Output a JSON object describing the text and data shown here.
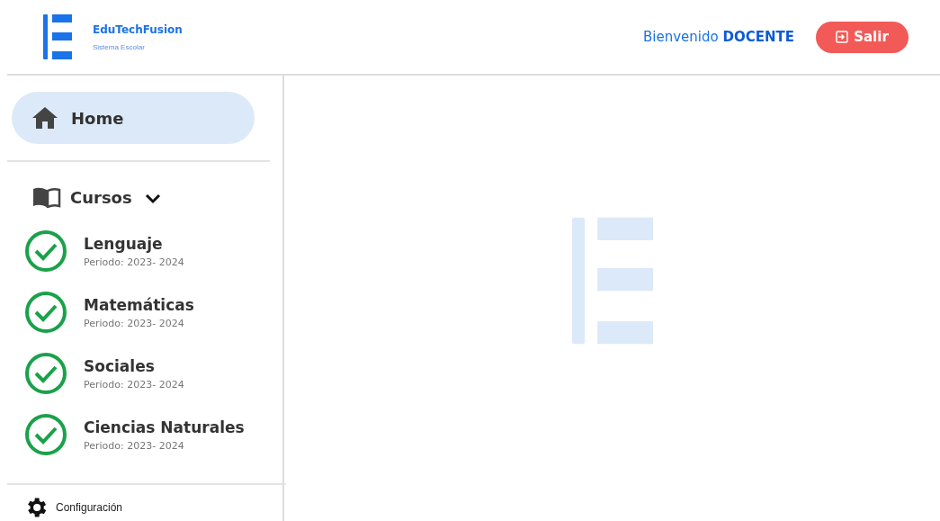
{
  "brand": {
    "name": "EduTechFusion",
    "subtitle": "Sistema Escolar"
  },
  "header": {
    "welcome": "Bienvenido **DOCENTE**",
    "logout_button": "Salir"
  },
  "sidebar": {
    "home": {
      "label": "Home",
      "selected": true
    },
    "courses": {
      "label": "Cursos",
      "expanded": true,
      "items": [
        {
          "name": "Lenguaje",
          "period": "Periodo: 2023- 2024"
        },
        {
          "name": "Matemáticas",
          "period": "Periodo: 2023- 2024"
        },
        {
          "name": "Sociales",
          "period": "Periodo: 2023- 2024"
        },
        {
          "name": "Ciencias Naturales",
          "period": "Periodo: 2023- 2024"
        }
      ]
    },
    "settings": {
      "label": "Configuración"
    }
  }
}
